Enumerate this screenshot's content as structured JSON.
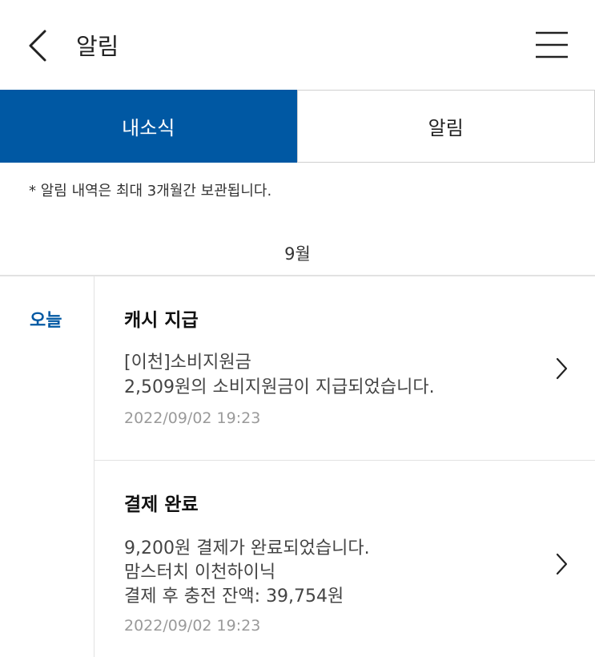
{
  "header": {
    "title": "알림",
    "back_icon": "chevron-left-icon",
    "menu_icon": "hamburger-menu-icon"
  },
  "tabs": [
    {
      "label": "내소식",
      "active": true
    },
    {
      "label": "알림",
      "active": false
    }
  ],
  "notice": "* 알림 내역은 최대 3개월간 보관됩니다.",
  "month": "9월",
  "day_label": "오늘",
  "items": [
    {
      "title": "캐시 지급",
      "lines": [
        "[이천]소비지원금",
        "2,509원의 소비지원금이 지급되었습니다."
      ],
      "date": "2022/09/02 19:23"
    },
    {
      "title": "결제 완료",
      "lines": [
        "9,200원 결제가 완료되었습니다.",
        "맘스터치 이천하이닉",
        "결제 후 충전 잔액: 39,754원"
      ],
      "date": "2022/09/02 19:23"
    }
  ],
  "colors": {
    "accent": "#0058a3",
    "text": "#222222",
    "muted": "#9a9a9a",
    "divider": "#e2e2e2"
  }
}
